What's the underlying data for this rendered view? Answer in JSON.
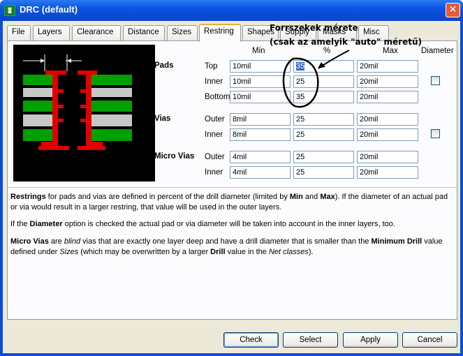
{
  "window": {
    "title": "DRC (default)",
    "app_icon": "eagle-app-icon",
    "close_symbol": "✕"
  },
  "tabs": [
    {
      "label": "File",
      "active": false
    },
    {
      "label": "Layers",
      "active": false
    },
    {
      "label": "Clearance",
      "active": false
    },
    {
      "label": "Distance",
      "active": false
    },
    {
      "label": "Sizes",
      "active": false
    },
    {
      "label": "Restring",
      "active": true
    },
    {
      "label": "Shapes",
      "active": false
    },
    {
      "label": "Supply",
      "active": false
    },
    {
      "label": "Masks",
      "active": false
    },
    {
      "label": "Misc",
      "active": false
    }
  ],
  "columns": {
    "min": "Min",
    "pct": "%",
    "max": "Max",
    "diameter": "Diameter"
  },
  "pads": {
    "label": "Pads",
    "rows": [
      {
        "label": "Top",
        "min": "10mil",
        "pct": "35",
        "max": "20mil"
      },
      {
        "label": "Inner",
        "min": "10mil",
        "pct": "25",
        "max": "20mil"
      },
      {
        "label": "Bottom",
        "min": "10mil",
        "pct": "35",
        "max": "20mil"
      }
    ],
    "diameter_checked": false
  },
  "vias": {
    "label": "Vias",
    "rows": [
      {
        "label": "Outer",
        "min": "8mil",
        "pct": "25",
        "max": "20mil"
      },
      {
        "label": "Inner",
        "min": "8mil",
        "pct": "25",
        "max": "20mil"
      }
    ],
    "diameter_checked": false
  },
  "micro_vias": {
    "label": "Micro Vias",
    "rows": [
      {
        "label": "Outer",
        "min": "4mil",
        "pct": "25",
        "max": "20mil"
      },
      {
        "label": "Inner",
        "min": "4mil",
        "pct": "25",
        "max": "20mil"
      }
    ]
  },
  "help": {
    "p1": [
      {
        "t": "Restrings",
        "b": true
      },
      {
        "t": " for pads and vias are defined in percent of the drill diameter (limited by "
      },
      {
        "t": "Min",
        "b": true
      },
      {
        "t": " and "
      },
      {
        "t": "Max",
        "b": true
      },
      {
        "t": "). If the diameter of an actual pad or via would result in a larger restring, that value will be used in the outer layers."
      }
    ],
    "p2": [
      {
        "t": "If the "
      },
      {
        "t": "Diameter",
        "b": true
      },
      {
        "t": " option is checked the actual pad or via diameter will be taken into account in the inner layers, too."
      }
    ],
    "p3": [
      {
        "t": "Micro Vias",
        "b": true
      },
      {
        "t": " are "
      },
      {
        "t": "blind",
        "i": true
      },
      {
        "t": " vias that are exactly one layer deep and have a drill diameter that is smaller than the "
      },
      {
        "t": "Minimum Drill",
        "b": true
      },
      {
        "t": " value defined under "
      },
      {
        "t": "Sizes",
        "i": true
      },
      {
        "t": " (which may be overwritten by a larger "
      },
      {
        "t": "Drill",
        "b": true
      },
      {
        "t": " value in the "
      },
      {
        "t": "Net classes",
        "i": true
      },
      {
        "t": ")."
      }
    ]
  },
  "buttons": {
    "check": "Check",
    "select": "Select",
    "apply": "Apply",
    "cancel": "Cancel"
  },
  "annotation": {
    "line1": "Forrszekek mérete",
    "line2": "(csak az amelyik \"auto\" méretű)"
  },
  "colors": {
    "pad_green": "#00a000",
    "copper_red": "#e00000",
    "layer_gray": "#c8c8c8",
    "titlebar": "#0a54e0"
  }
}
